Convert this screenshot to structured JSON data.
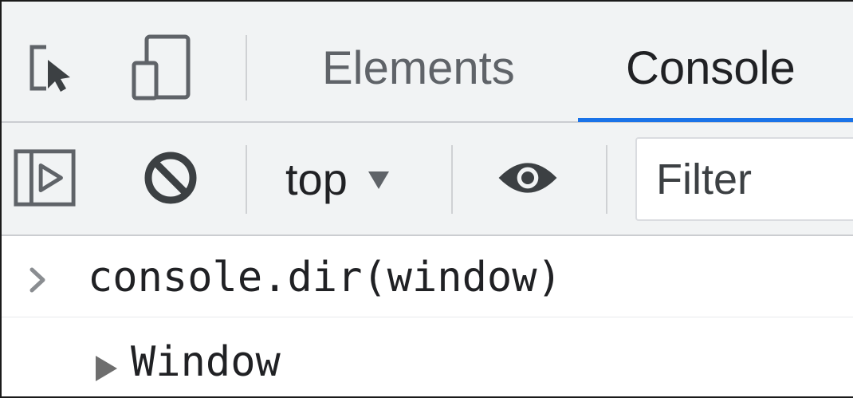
{
  "tabbar": {
    "tabs": [
      {
        "label": "Elements",
        "active": false
      },
      {
        "label": "Console",
        "active": true
      }
    ],
    "active_color": "#1a73e8"
  },
  "toolbar": {
    "context_label": "top",
    "filter_placeholder": "Filter"
  },
  "console": {
    "input_prompt": ">",
    "input_command": "console.dir(window)",
    "output_value": "Window"
  },
  "icons": {
    "inspect": "inspect-element-icon",
    "device": "device-toolbar-icon",
    "sidebar": "show-sidebar-icon",
    "clear": "clear-console-icon",
    "eye": "live-expression-icon"
  }
}
